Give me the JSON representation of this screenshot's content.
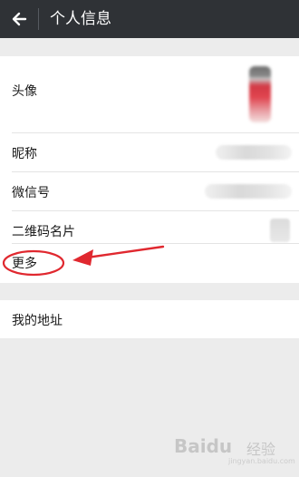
{
  "header": {
    "title": "个人信息",
    "back_icon": "arrow-left-icon",
    "background": "#2f3236"
  },
  "profile": {
    "rows": [
      {
        "label": "头像"
      },
      {
        "label": "昵称"
      },
      {
        "label": "微信号"
      },
      {
        "label": "二维码名片"
      },
      {
        "label": "更多"
      }
    ]
  },
  "address": {
    "label": "我的地址"
  },
  "annotation": {
    "color": "#e0282f"
  },
  "watermark": {
    "text": "Baidu",
    "text2": "经验",
    "url": "jingyan.baidu.com"
  }
}
